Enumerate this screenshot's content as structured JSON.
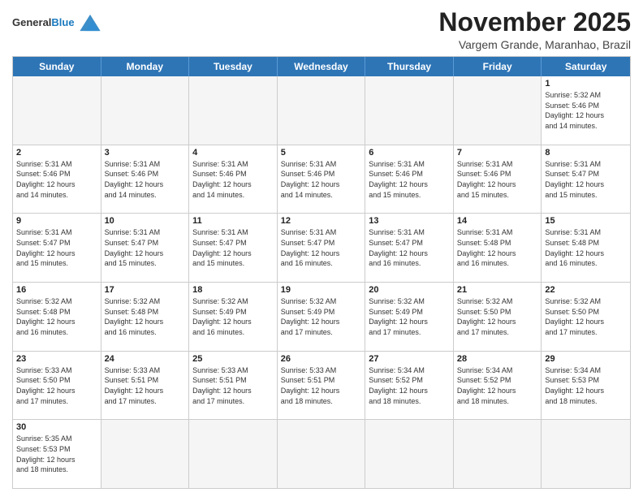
{
  "header": {
    "logo_line1": "General",
    "logo_line2": "Blue",
    "month_title": "November 2025",
    "location": "Vargem Grande, Maranhao, Brazil"
  },
  "days_of_week": [
    "Sunday",
    "Monday",
    "Tuesday",
    "Wednesday",
    "Thursday",
    "Friday",
    "Saturday"
  ],
  "weeks": [
    [
      {
        "day": "",
        "info": ""
      },
      {
        "day": "",
        "info": ""
      },
      {
        "day": "",
        "info": ""
      },
      {
        "day": "",
        "info": ""
      },
      {
        "day": "",
        "info": ""
      },
      {
        "day": "",
        "info": ""
      },
      {
        "day": "1",
        "info": "Sunrise: 5:32 AM\nSunset: 5:46 PM\nDaylight: 12 hours\nand 14 minutes."
      }
    ],
    [
      {
        "day": "2",
        "info": "Sunrise: 5:31 AM\nSunset: 5:46 PM\nDaylight: 12 hours\nand 14 minutes."
      },
      {
        "day": "3",
        "info": "Sunrise: 5:31 AM\nSunset: 5:46 PM\nDaylight: 12 hours\nand 14 minutes."
      },
      {
        "day": "4",
        "info": "Sunrise: 5:31 AM\nSunset: 5:46 PM\nDaylight: 12 hours\nand 14 minutes."
      },
      {
        "day": "5",
        "info": "Sunrise: 5:31 AM\nSunset: 5:46 PM\nDaylight: 12 hours\nand 14 minutes."
      },
      {
        "day": "6",
        "info": "Sunrise: 5:31 AM\nSunset: 5:46 PM\nDaylight: 12 hours\nand 15 minutes."
      },
      {
        "day": "7",
        "info": "Sunrise: 5:31 AM\nSunset: 5:46 PM\nDaylight: 12 hours\nand 15 minutes."
      },
      {
        "day": "8",
        "info": "Sunrise: 5:31 AM\nSunset: 5:47 PM\nDaylight: 12 hours\nand 15 minutes."
      }
    ],
    [
      {
        "day": "9",
        "info": "Sunrise: 5:31 AM\nSunset: 5:47 PM\nDaylight: 12 hours\nand 15 minutes."
      },
      {
        "day": "10",
        "info": "Sunrise: 5:31 AM\nSunset: 5:47 PM\nDaylight: 12 hours\nand 15 minutes."
      },
      {
        "day": "11",
        "info": "Sunrise: 5:31 AM\nSunset: 5:47 PM\nDaylight: 12 hours\nand 15 minutes."
      },
      {
        "day": "12",
        "info": "Sunrise: 5:31 AM\nSunset: 5:47 PM\nDaylight: 12 hours\nand 16 minutes."
      },
      {
        "day": "13",
        "info": "Sunrise: 5:31 AM\nSunset: 5:47 PM\nDaylight: 12 hours\nand 16 minutes."
      },
      {
        "day": "14",
        "info": "Sunrise: 5:31 AM\nSunset: 5:48 PM\nDaylight: 12 hours\nand 16 minutes."
      },
      {
        "day": "15",
        "info": "Sunrise: 5:31 AM\nSunset: 5:48 PM\nDaylight: 12 hours\nand 16 minutes."
      }
    ],
    [
      {
        "day": "16",
        "info": "Sunrise: 5:32 AM\nSunset: 5:48 PM\nDaylight: 12 hours\nand 16 minutes."
      },
      {
        "day": "17",
        "info": "Sunrise: 5:32 AM\nSunset: 5:48 PM\nDaylight: 12 hours\nand 16 minutes."
      },
      {
        "day": "18",
        "info": "Sunrise: 5:32 AM\nSunset: 5:49 PM\nDaylight: 12 hours\nand 16 minutes."
      },
      {
        "day": "19",
        "info": "Sunrise: 5:32 AM\nSunset: 5:49 PM\nDaylight: 12 hours\nand 17 minutes."
      },
      {
        "day": "20",
        "info": "Sunrise: 5:32 AM\nSunset: 5:49 PM\nDaylight: 12 hours\nand 17 minutes."
      },
      {
        "day": "21",
        "info": "Sunrise: 5:32 AM\nSunset: 5:50 PM\nDaylight: 12 hours\nand 17 minutes."
      },
      {
        "day": "22",
        "info": "Sunrise: 5:32 AM\nSunset: 5:50 PM\nDaylight: 12 hours\nand 17 minutes."
      }
    ],
    [
      {
        "day": "23",
        "info": "Sunrise: 5:33 AM\nSunset: 5:50 PM\nDaylight: 12 hours\nand 17 minutes."
      },
      {
        "day": "24",
        "info": "Sunrise: 5:33 AM\nSunset: 5:51 PM\nDaylight: 12 hours\nand 17 minutes."
      },
      {
        "day": "25",
        "info": "Sunrise: 5:33 AM\nSunset: 5:51 PM\nDaylight: 12 hours\nand 17 minutes."
      },
      {
        "day": "26",
        "info": "Sunrise: 5:33 AM\nSunset: 5:51 PM\nDaylight: 12 hours\nand 18 minutes."
      },
      {
        "day": "27",
        "info": "Sunrise: 5:34 AM\nSunset: 5:52 PM\nDaylight: 12 hours\nand 18 minutes."
      },
      {
        "day": "28",
        "info": "Sunrise: 5:34 AM\nSunset: 5:52 PM\nDaylight: 12 hours\nand 18 minutes."
      },
      {
        "day": "29",
        "info": "Sunrise: 5:34 AM\nSunset: 5:53 PM\nDaylight: 12 hours\nand 18 minutes."
      }
    ],
    [
      {
        "day": "30",
        "info": "Sunrise: 5:35 AM\nSunset: 5:53 PM\nDaylight: 12 hours\nand 18 minutes."
      },
      {
        "day": "",
        "info": ""
      },
      {
        "day": "",
        "info": ""
      },
      {
        "day": "",
        "info": ""
      },
      {
        "day": "",
        "info": ""
      },
      {
        "day": "",
        "info": ""
      },
      {
        "day": "",
        "info": ""
      }
    ]
  ]
}
